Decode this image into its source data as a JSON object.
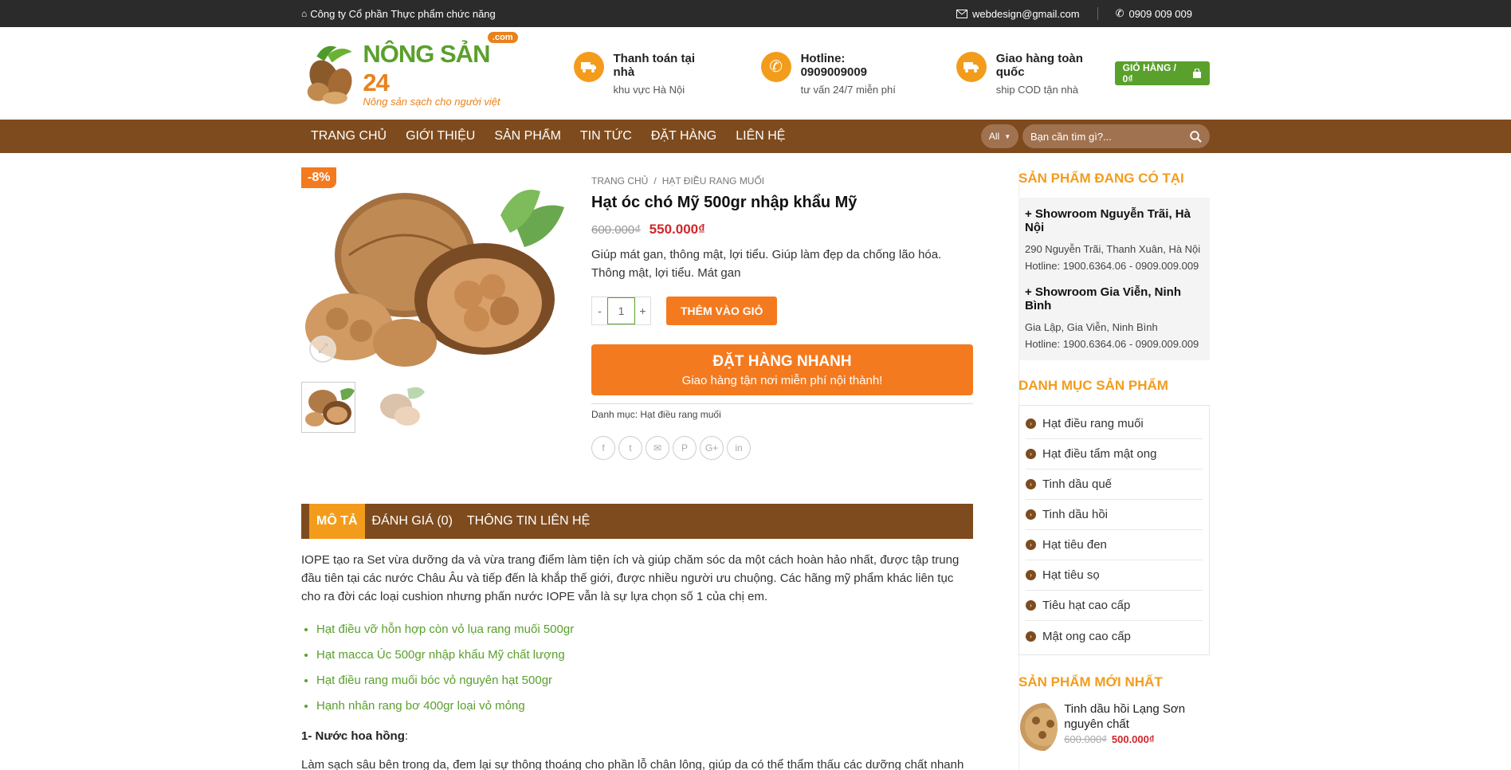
{
  "topbar": {
    "company": "Công ty Cổ phần Thực phẩm chức năng",
    "email": "webdesign@gmail.com",
    "phone": "0909 009 009"
  },
  "logo": {
    "brand_a": "NÔNG SẢN",
    "brand_b": "24",
    "com": ".com",
    "slogan": "Nông sản sạch cho người việt"
  },
  "header_info": [
    {
      "title": "Thanh toán tại nhà",
      "sub": "khu vực Hà Nội",
      "icon": "truck-icon"
    },
    {
      "title": "Hotline: 0909009009",
      "sub": "tư vấn 24/7 miễn phí",
      "icon": "phone-icon"
    },
    {
      "title": "Giao hàng toàn quốc",
      "sub": "ship COD tận nhà",
      "icon": "truck-icon"
    }
  ],
  "cart": {
    "label": "GIỎ HÀNG / 0₫"
  },
  "nav": {
    "items": [
      "TRANG CHỦ",
      "GIỚI THIỆU",
      "SẢN PHẨM",
      "TIN TỨC",
      "ĐẶT HÀNG",
      "LIÊN HỆ"
    ],
    "select": "All",
    "search_placeholder": "Bạn cần tìm gì?..."
  },
  "product": {
    "badge": "-8%",
    "breadcrumb": [
      "TRANG CHỦ",
      "HẠT ĐIỀU RANG MUỐI"
    ],
    "title": "Hạt óc chó Mỹ 500gr nhập khẩu Mỹ",
    "old_price": "600.000₫",
    "new_price": "550.000₫",
    "short_desc": "Giúp mát gan, thông mật, lợi tiểu. Giúp làm đẹp da chống lão hóa. Thông mật, lợi tiểu. Mát gan",
    "qty_minus": "-",
    "qty_value": "1",
    "qty_plus": "+",
    "add_to_cart": "THÊM VÀO GIỎ",
    "quick_title": "ĐẶT HÀNG NHANH",
    "quick_sub": "Giao hàng tận nơi miễn phí nội thành!",
    "category_label": "Danh mục:",
    "category_value": "Hạt điều rang muối",
    "share_icons": [
      "facebook-icon",
      "twitter-icon",
      "email-icon",
      "pinterest-icon",
      "googleplus-icon",
      "linkedin-icon"
    ]
  },
  "tabs": [
    "MÔ TẢ",
    "ĐÁNH GIÁ (0)",
    "THÔNG TIN LIÊN HỆ"
  ],
  "description": {
    "intro": "IOPE tạo ra Set vừa dưỡng da và vừa trang điểm làm tiện ích và giúp chăm sóc da một cách hoàn hảo nhất,  được tập trung đầu tiên tại các nước Châu Âu và tiếp đến là khắp thế giới, được nhiều người ưu chuộng. Các  hãng mỹ phẩm khác liên tục cho ra đời các loại cushion nhưng phấn nước IOPE vẫn là sự lựa chọn số 1 của chị em.",
    "links": [
      "Hạt điều vỡ hỗn hợp còn vỏ lụa rang muối 500gr",
      "Hạt macca Úc 500gr nhập khẩu Mỹ chất lượng",
      "Hạt điều rang muối bóc vỏ nguyên hạt 500gr",
      "Hạnh nhân rang bơ 400gr loại vỏ mỏng"
    ],
    "heading": "1- Nước hoa hồng",
    "heading_suffix": ":",
    "para2": "Làm sạch sâu bên trong da, đem lại sự thông thoáng cho phần lỗ chân lông, giúp da có thể thẩm thấu các dưỡng chất nhanh và"
  },
  "sidebar": {
    "showroom_heading": "SẢN PHẨM ĐANG CÓ TẠI",
    "showrooms": [
      {
        "title": "+ Showroom Nguyễn Trãi, Hà Nội",
        "address": "290 Nguyễn Trãi, Thanh Xuân, Hà Nội",
        "hotline": "Hotline: 1900.6364.06 - 0909.009.009"
      },
      {
        "title": "+ Showroom Gia Viễn, Ninh Bình",
        "address": "Gia Lập, Gia Viễn, Ninh Bình",
        "hotline": "Hotline: 1900.6364.06 - 0909.009.009"
      }
    ],
    "category_heading": "DANH MỤC SẢN PHẨM",
    "categories": [
      "Hạt điều rang muối",
      "Hạt điều tẩm mật ong",
      "Tinh dầu quế",
      "Tinh dầu hồi",
      "Hạt tiêu đen",
      "Hạt tiêu sọ",
      "Tiêu hạt cao cấp",
      "Mật ong cao cấp"
    ],
    "newest_heading": "SẢN PHẨM MỚI NHẤT",
    "newest": {
      "title": "Tinh dầu hồi Lạng Sơn nguyên chất",
      "old": "600.000₫",
      "new": "500.000₫"
    }
  },
  "colors": {
    "brown": "#7e4b1e",
    "orange": "#f47a1f",
    "gold": "#f39c1c",
    "green": "#5aa02c",
    "red": "#d1262a"
  }
}
